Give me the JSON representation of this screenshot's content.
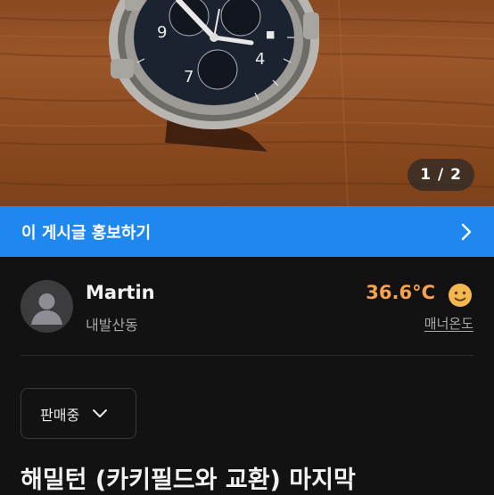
{
  "gallery": {
    "page_indicator": "1 / 2"
  },
  "promo": {
    "label": "이 게시글 홍보하기",
    "icon": "chevron-right-icon"
  },
  "seller": {
    "name": "Martin",
    "location": "내발산동",
    "manner_temperature": "36.6°C",
    "manner_label": "매너온도",
    "avatar_icon": "default-avatar-icon",
    "manner_face_icon": "smiling-face-icon"
  },
  "listing": {
    "status": "판매중",
    "title": "해밀턴 (카키필드와 교환)  마지막"
  },
  "colors": {
    "background": "#121212",
    "promo_blue": "#1e87f0",
    "manner_orange": "#f6a24e"
  }
}
